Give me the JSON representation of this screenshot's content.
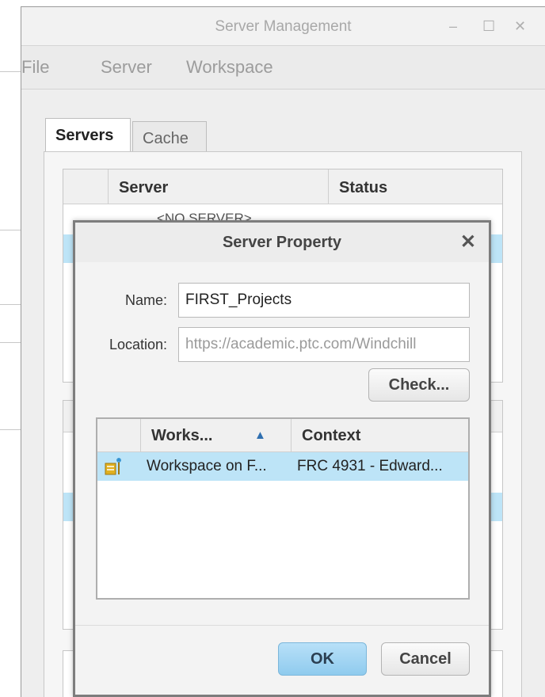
{
  "background_window": {
    "title": "Server Management",
    "controls": {
      "minimize": "–",
      "maximize": "☐",
      "close": "✕"
    },
    "menu": [
      "File",
      "Server",
      "Workspace"
    ],
    "tabs": [
      {
        "label": "Servers",
        "active": true
      },
      {
        "label": "Cache",
        "active": false
      }
    ],
    "servers_table": {
      "columns": [
        "Server",
        "Status"
      ],
      "first_row_text": "<NO SERVER>"
    }
  },
  "dialog": {
    "title": "Server Property",
    "close_glyph": "✕",
    "name_label": "Name:",
    "name_value": "FIRST_Projects",
    "location_label": "Location:",
    "location_value": "https://academic.ptc.com/Windchill",
    "check_button": "Check...",
    "workspace_table": {
      "columns": [
        "Works...",
        "Context"
      ],
      "sort_indicator": "▲",
      "rows": [
        {
          "icon": "workspace-icon",
          "workspace": "Workspace on F...",
          "context": "FRC 4931 - Edward..."
        }
      ]
    },
    "ok_button": "OK",
    "cancel_button": "Cancel"
  },
  "colors": {
    "selection": "#bde4f7",
    "primary_button": "#8fcbee",
    "icon_gold": "#e0b020",
    "icon_blue": "#2f8fd0"
  }
}
